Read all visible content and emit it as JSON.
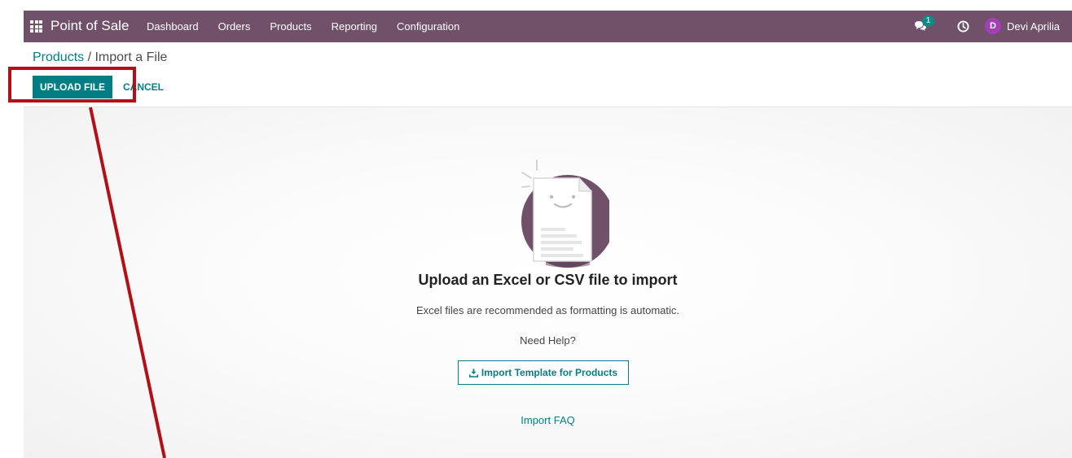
{
  "navbar": {
    "app_name": "Point of Sale",
    "menu": [
      "Dashboard",
      "Orders",
      "Products",
      "Reporting",
      "Configuration"
    ],
    "chat_badge": "1",
    "user_initial": "D",
    "user_name": "Devi Aprilia"
  },
  "breadcrumb": {
    "parent": "Products",
    "separator": " / ",
    "current": "Import a File"
  },
  "actions": {
    "upload_label": "UPLOAD FILE",
    "cancel_label": "CANCEL"
  },
  "content": {
    "title": "Upload an Excel or CSV file to import",
    "subtitle": "Excel files are recommended as formatting is automatic.",
    "help": "Need Help?",
    "template_button": "Import Template for Products",
    "faq_link": "Import FAQ"
  },
  "icons": {
    "apps": "apps-grid-icon",
    "chat": "chat-icon",
    "clock": "clock-icon",
    "download": "download-icon",
    "illustration": "document-smiley-illustration"
  },
  "colors": {
    "navbar": "#71506a",
    "primary": "#017e84",
    "badge": "#0e8a87",
    "avatar": "#a53fb7",
    "annotation": "#b30f17"
  }
}
